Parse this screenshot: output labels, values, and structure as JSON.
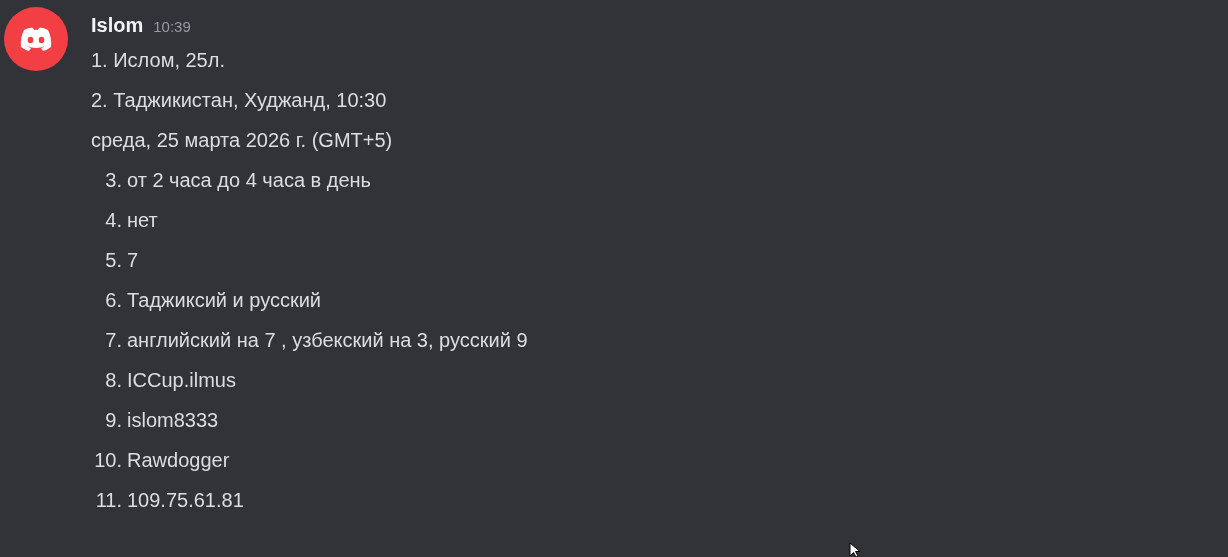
{
  "message": {
    "author": "Islom",
    "time": "10:39",
    "lines": [
      {
        "kind": "paragraph",
        "text": "1. Ислом, 25л."
      },
      {
        "kind": "paragraph",
        "text": "2. Таджикистан, Худжанд, 10:30"
      },
      {
        "kind": "paragraph",
        "text": "среда, 25 марта 2026 г. (GMT+5)"
      },
      {
        "kind": "list_item",
        "number": "3.",
        "text": "от 2 часа до 4 часа в день"
      },
      {
        "kind": "list_item",
        "number": "4.",
        "text": "нет"
      },
      {
        "kind": "list_item",
        "number": "5.",
        "text": "7"
      },
      {
        "kind": "list_item",
        "number": "6.",
        "text": "Таджиксий и русский"
      },
      {
        "kind": "list_item",
        "number": "7.",
        "text": "английский на 7 , узбекский на 3, русский 9"
      },
      {
        "kind": "list_item",
        "number": "8.",
        "text": "ICCup.ilmus"
      },
      {
        "kind": "list_item",
        "number": "9.",
        "text": "islom8333"
      },
      {
        "kind": "list_item",
        "number": "10.",
        "text": "Rawdogger"
      },
      {
        "kind": "list_item",
        "number": "11.",
        "text": "109.75.61.81"
      }
    ]
  }
}
